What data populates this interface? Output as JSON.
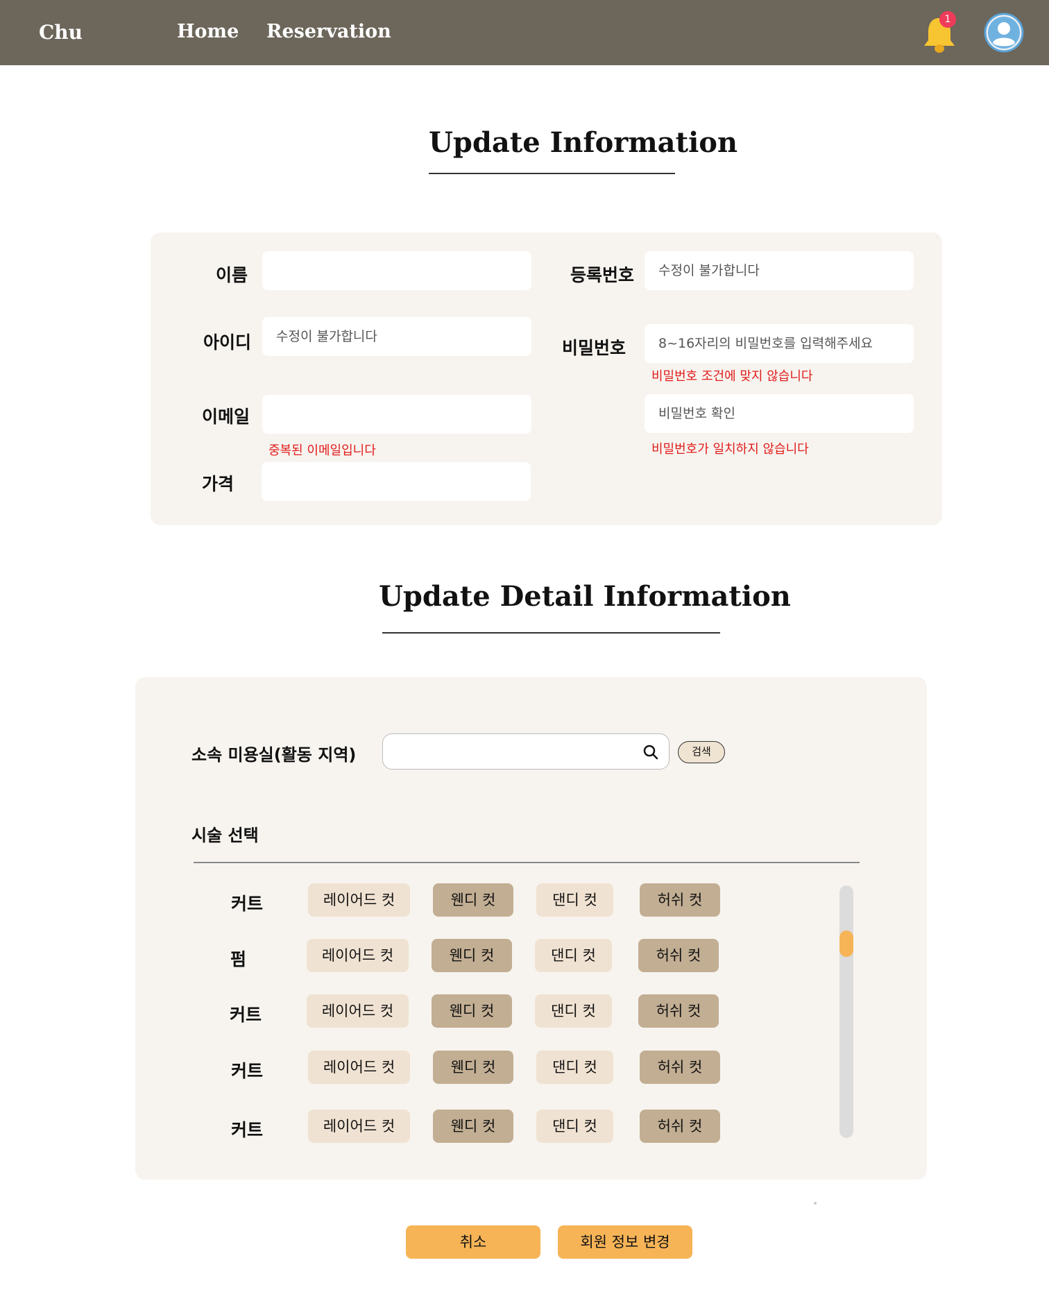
{
  "nav": {
    "brand": "Chu",
    "links": [
      "Home",
      "Reservation"
    ],
    "notification_count": "1"
  },
  "section1": {
    "title": "Update Information",
    "fields": {
      "name_label": "이름",
      "id_label": "아이디",
      "id_placeholder": "수정이 불가합니다",
      "email_label": "이메일",
      "email_error": "중복된 이메일입니다",
      "price_label": "가격",
      "reg_label": "등록번호",
      "reg_placeholder": "수정이 불가합니다",
      "password_label": "비밀번호",
      "password_placeholder": "8~16자리의 비밀번호를 입력해주세요",
      "password_error": "비밀번호 조건에 맞지 않습니다",
      "password_confirm_placeholder": "비밀번호 확인",
      "password_confirm_error": "비밀번호가 일치하지 않습니다"
    }
  },
  "section2": {
    "title": "Update Detail Information",
    "salon_label": "소속 미용실(활동 지역)",
    "search_button": "검색",
    "service_title": "시술 선택",
    "rows": [
      {
        "category": "커트",
        "options": [
          "레이어드 컷",
          "웬디 컷",
          "댄디 컷",
          "허쉬 컷"
        ]
      },
      {
        "category": "펌",
        "options": [
          "레이어드 컷",
          "웬디 컷",
          "댄디 컷",
          "허쉬 컷"
        ]
      },
      {
        "category": "커트",
        "options": [
          "레이어드 컷",
          "웬디 컷",
          "댄디 컷",
          "허쉬 컷"
        ]
      },
      {
        "category": "커트",
        "options": [
          "레이어드 컷",
          "웬디 컷",
          "댄디 컷",
          "허쉬 컷"
        ]
      },
      {
        "category": "커트",
        "options": [
          "레이어드 컷",
          "웬디 컷",
          "댄디 컷",
          "허쉬 컷"
        ]
      }
    ]
  },
  "actions": {
    "cancel": "취소",
    "submit": "회원 정보 변경"
  },
  "colors": {
    "nav_bg": "#6c665b",
    "panel_bg": "#f7f4ef",
    "chip_light": "#f0e2d2",
    "chip_dark": "#c2ae93",
    "accent": "#f6b457",
    "error": "#e01b1b"
  }
}
